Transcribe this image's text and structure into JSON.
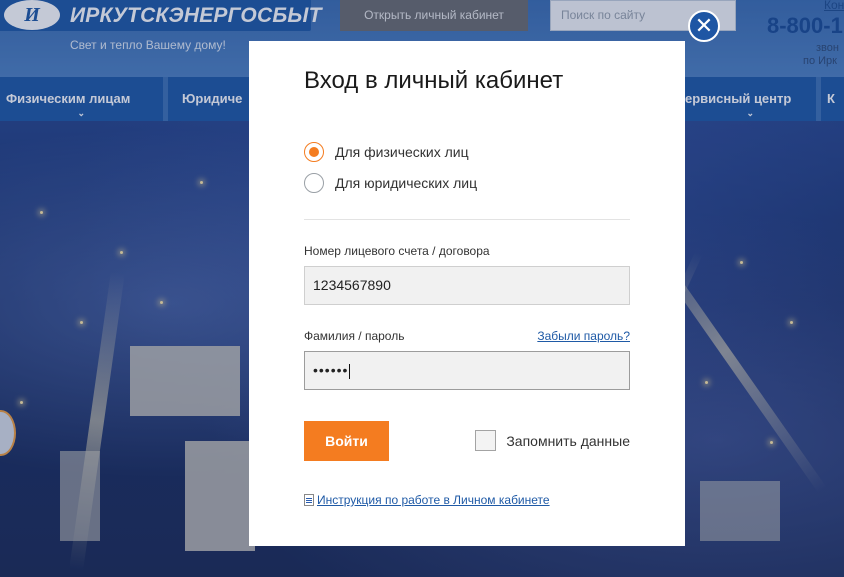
{
  "site": {
    "logo_mark": "И",
    "logo_text": "ИРКУТСКЭНЕРГОСБЫТ",
    "slogan": "Свет и тепло Вашему дому!",
    "cabinet_button": "Открыть личный кабинет",
    "search_placeholder": "Поиск по сайту",
    "top_link": "Кон",
    "phone": "8-800-1",
    "phone_note_1": "звон",
    "phone_note_2": "по Ирк"
  },
  "nav": {
    "items": [
      {
        "label": "Физическим лицам"
      },
      {
        "label": "Юридиче"
      },
      {
        "label": "ервисный центр"
      },
      {
        "label": "К"
      }
    ],
    "chevron": "⌄"
  },
  "modal": {
    "title": "Вход в личный кабинет",
    "close_symbol": "✕",
    "radios": [
      {
        "label": "Для физических лиц",
        "checked": true
      },
      {
        "label": "Для юридических лиц",
        "checked": false
      }
    ],
    "account_label": "Номер лицевого счета / договора",
    "account_value": "1234567890",
    "password_label": "Фамилия / пароль",
    "password_value": "••••••",
    "forgot_link": "Забыли пароль?",
    "login_button": "Войти",
    "remember_label": "Запомнить данные",
    "instruction_link": "Инструкция по работе в Личном кабинете"
  },
  "colors": {
    "accent_orange": "#f47c20",
    "brand_blue": "#1f5aa6"
  },
  "icons": [
    "logo-emblem-icon",
    "close-icon",
    "chevron-down-icon",
    "document-icon"
  ]
}
